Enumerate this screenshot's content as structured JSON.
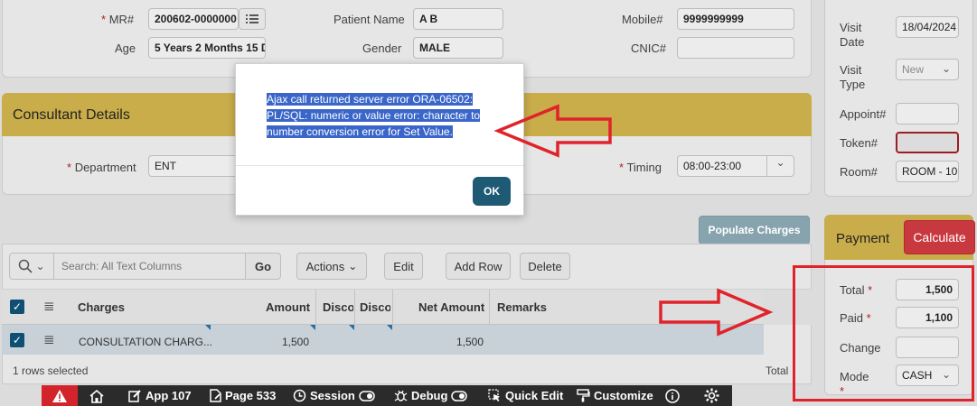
{
  "patient": {
    "mr_label": "MR#",
    "mr_value": "200602-0000000",
    "name_label": "Patient Name",
    "name_value": "A  B",
    "mobile_label": "Mobile#",
    "mobile_value": "9999999999",
    "age_label": "Age",
    "age_value": "5 Years 2 Months 15 D",
    "gender_label": "Gender",
    "gender_value": "MALE",
    "cnic_label": "CNIC#",
    "cnic_value": ""
  },
  "visit": {
    "visit_date_label_1": "Visit",
    "visit_date_label_2": "Date",
    "visit_date_value": "18/04/2024",
    "visit_type_label_1": "Visit",
    "visit_type_label_2": "Type",
    "visit_type_value": "New",
    "appoint_label": "Appoint#",
    "appoint_value": "",
    "token_label": "Token#",
    "token_value": "",
    "room_label": "Room#",
    "room_value": "ROOM - 10"
  },
  "consultant": {
    "title": "Consultant Details",
    "department_label": "Department",
    "department_value": "ENT",
    "timing_label": "Timing",
    "timing_value": "08:00-23:00"
  },
  "payment": {
    "title": "Payment",
    "calculate_label": "Calculate",
    "total_label": "Total",
    "total_value": "1,500",
    "paid_label": "Paid",
    "paid_value": "1,100",
    "change_label": "Change",
    "change_value": "",
    "mode_label": "Mode",
    "mode_value": "CASH"
  },
  "charges": {
    "populate_label": "Populate Charges",
    "search_placeholder": "Search: All Text Columns",
    "go_label": "Go",
    "actions_label": "Actions",
    "edit_label": "Edit",
    "add_row_label": "Add Row",
    "delete_label": "Delete",
    "columns": [
      "Charges",
      "Amount",
      "Disco",
      "Disco",
      "Net Amount",
      "Remarks"
    ],
    "rows": [
      {
        "charges": "CONSULTATION CHARG...",
        "amount": "1,500",
        "net_amount": "1,500"
      }
    ],
    "rows_selected": "1 rows selected",
    "total_label": "Total"
  },
  "dialog": {
    "message": "Ajax call returned server error ORA-06502: PL/SQL: numeric or value error: character to number conversion error for Set Value.",
    "ok_label": "OK"
  },
  "devbar": {
    "app": "App 107",
    "page": "Page 533",
    "session": "Session",
    "debug": "Debug",
    "quick_edit": "Quick Edit",
    "customize": "Customize"
  },
  "colors": {
    "section_header": "#c9ad4a",
    "calculate_button": "#c8393f",
    "populate_button": "#87a3ad",
    "ok_button": "#1e5a73",
    "annotation_red": "#e0232b",
    "selection_blue": "#3a66c9",
    "toolbar_bg": "#2b2b2b"
  }
}
